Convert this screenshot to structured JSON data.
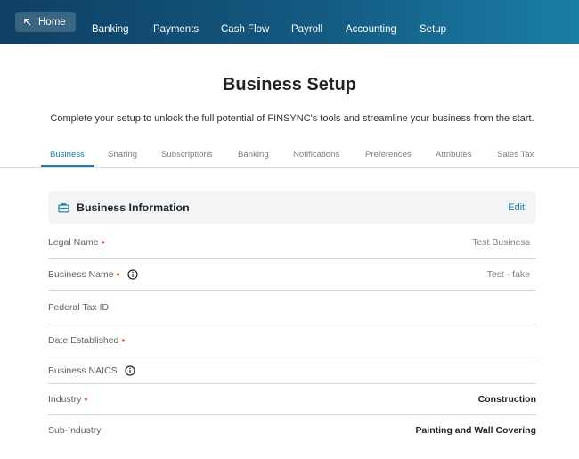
{
  "nav": {
    "home_label": "Home",
    "items": [
      "Banking",
      "Payments",
      "Cash Flow",
      "Payroll",
      "Accounting",
      "Setup"
    ]
  },
  "page": {
    "title": "Business Setup",
    "subtitle": "Complete your setup to unlock the full potential of FINSYNC's tools and streamline your business from the start."
  },
  "tabs": {
    "items": [
      "Business",
      "Sharing",
      "Subscriptions",
      "Banking",
      "Notifications",
      "Preferences",
      "Attributes",
      "Sales Tax"
    ],
    "active": "Business"
  },
  "card": {
    "title": "Business Information",
    "edit_label": "Edit",
    "icon": "briefcase-icon"
  },
  "fields": [
    {
      "label": "Legal Name",
      "required": true,
      "info": false,
      "value": "Test Business"
    },
    {
      "label": "Business Name",
      "required": true,
      "info": true,
      "value": "Test - fake"
    },
    {
      "label": "Federal Tax ID",
      "required": false,
      "info": false,
      "value": ""
    },
    {
      "label": "Date Established",
      "required": true,
      "info": false,
      "value": ""
    },
    {
      "label": "Business NAICS",
      "required": false,
      "info": true,
      "value": ""
    },
    {
      "label": "Industry",
      "required": true,
      "info": false,
      "value": "Construction"
    },
    {
      "label": "Sub-Industry",
      "required": false,
      "info": false,
      "value": "Painting and Wall Covering"
    }
  ],
  "colors": {
    "accent": "#1a7ea6",
    "required_dot": "#e0522a",
    "nav_gradient_start": "#0f3f63",
    "nav_gradient_end": "#1a7ea6"
  }
}
